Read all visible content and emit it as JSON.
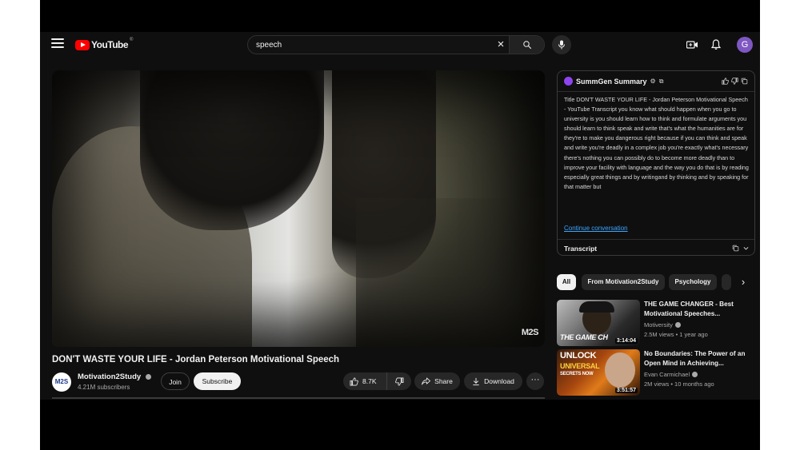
{
  "header": {
    "logo_text": "YouTube",
    "logo_sup": "®",
    "search": {
      "value": "speech",
      "placeholder": "Search"
    },
    "avatar_letter": "G"
  },
  "video": {
    "watermark": "M2S",
    "title": "DON'T WASTE YOUR LIFE - Jordan Peterson Motivational Speech",
    "channel": {
      "avatar_text": "M2S",
      "name": "Motivation2Study",
      "subscribers": "4.21M subscribers"
    },
    "actions": {
      "join": "Join",
      "subscribe": "Subscribe",
      "likes": "8.7K",
      "share": "Share",
      "download": "Download",
      "more": "···"
    }
  },
  "summary": {
    "title": "SummGen Summary",
    "body": "Title DON'T WASTE YOUR LIFE - Jordan Peterson Motivational Speech - YouTube Transcript you know what should happen when you go to university is you should learn how to think and formulate arguments you should learn to think speak and write that's what the humanities are for they're to make you dangerous right because if you can think and speak and write you're deadly in a complex job you're exactly what's necessary there's nothing you can possibly do to become more deadly than to improve your facility with language and the way you do that is by reading especially great things and by writingand by thinking and by speaking for that matter but",
    "continue_label": "Continue conversation",
    "transcript_label": "Transcript"
  },
  "chips": {
    "items": [
      "All",
      "From Motivation2Study",
      "Psychology"
    ],
    "next": "›"
  },
  "recommendations": [
    {
      "title": "THE GAME CHANGER - Best Motivational Speeches...",
      "channel": "Motiversity",
      "meta": "2.5M views • 1 year ago",
      "thumb_text": "THE GAME CH",
      "duration": "3:14:04"
    },
    {
      "title": "No Boundaries: The Power of an Open Mind in Achieving...",
      "channel": "Evan Carmichael",
      "meta": "2M views • 10 months ago",
      "thumb_line1": "UNLOCK",
      "thumb_line2": "UNIVERSAL",
      "thumb_line3": "SECRETS NOW",
      "duration": "3:51:57"
    }
  ],
  "colors": {
    "background": "#0f0f0f",
    "brand_red": "#ff0000",
    "link_blue": "#3ea6ff",
    "avatar_purple": "#7e57c2",
    "summgen_purple": "#8e44ef"
  }
}
